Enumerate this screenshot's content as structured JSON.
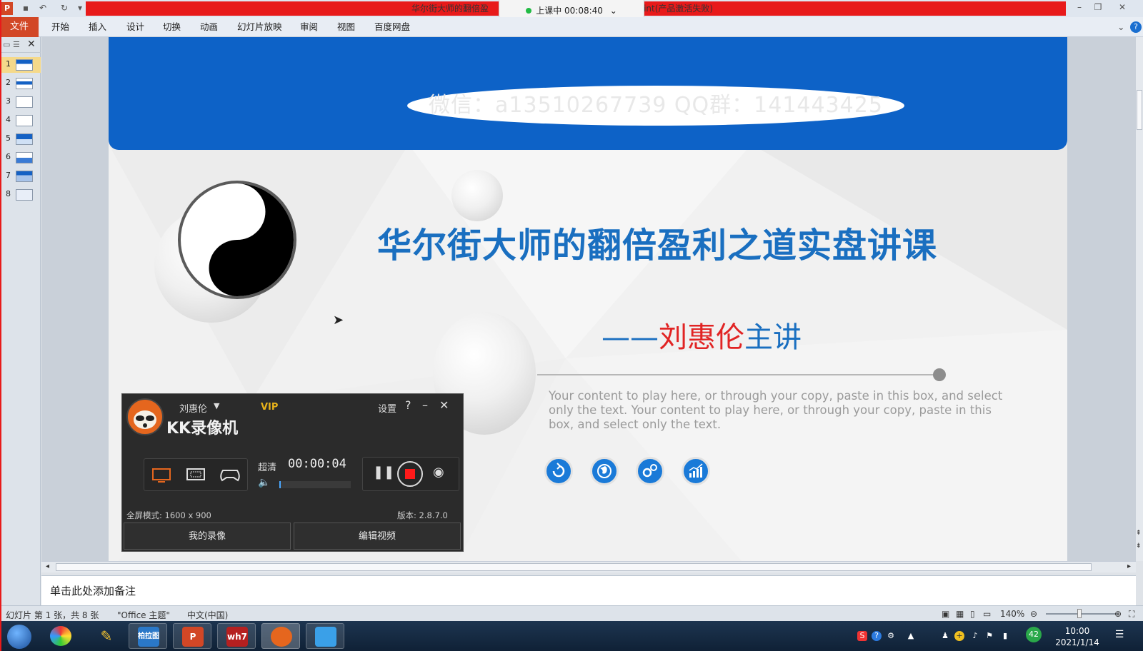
{
  "window": {
    "title_left": "华尔街大师的翻倍盈",
    "title_right": "rPoint(产品激活失败)",
    "live_status": "上课中 00:08:40",
    "app_logo": "P"
  },
  "ribbon": {
    "tabs": [
      "文件",
      "开始",
      "插入",
      "设计",
      "切换",
      "动画",
      "幻灯片放映",
      "审阅",
      "视图",
      "百度网盘"
    ]
  },
  "slides_panel": {
    "numbers": [
      "1",
      "2",
      "3",
      "4",
      "5",
      "6",
      "7",
      "8"
    ],
    "selected": 1
  },
  "slide": {
    "contact": "微信：a13510267739   QQ群：141443425",
    "title": "华尔街大师的翻倍盈利之道实盘讲课",
    "subtitle_dash": "——",
    "subtitle_name": "刘惠伦",
    "subtitle_tail": "主讲",
    "body": "Your content to play here, or through your copy, paste in this box, and select only the text. Your content to play here, or through your copy, paste in this box, and select only the text.",
    "icons": [
      "refresh-icon",
      "globe-icon",
      "gears-icon",
      "chart-icon"
    ],
    "colors": {
      "banner": "#0d62c7",
      "title": "#1a6fc0",
      "name": "#e12424"
    }
  },
  "notes": {
    "placeholder": "单击此处添加备注"
  },
  "statusbar": {
    "slide_info": "幻灯片 第 1 张，共 8 张",
    "theme": "\"Office 主题\"",
    "language": "中文(中国)",
    "zoom": "140%"
  },
  "kk_recorder": {
    "user": "刘惠伦",
    "vip": "VIP",
    "app_name": "KK录像机",
    "settings": "设置",
    "help": "?",
    "quality": "超清",
    "elapsed": "00:00:04",
    "mode": "全屏模式: 1600 x 900",
    "version": "版本: 2.8.7.0",
    "my_recordings": "我的录像",
    "edit_video": "编辑视频"
  },
  "taskbar": {
    "time": "10:00",
    "date": "2021/1/14",
    "tray_badge": "42",
    "apps": [
      "柏拉图",
      "P",
      "wh7"
    ]
  }
}
